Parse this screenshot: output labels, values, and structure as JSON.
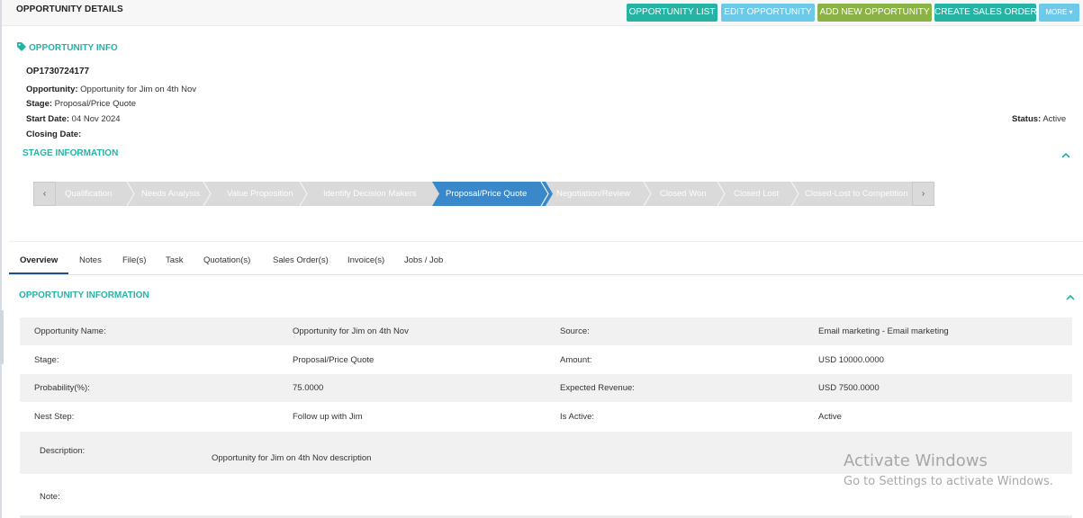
{
  "header": {
    "title": "OPPORTUNITY DETAILS",
    "buttons": {
      "list": "OPPORTUNITY LIST",
      "edit": "EDIT OPPORTUNITY",
      "add": "ADD NEW OPPORTUNITY",
      "sales_order": "CREATE SALES ORDER",
      "more": "MORE ▾"
    }
  },
  "info": {
    "title": "OPPORTUNITY INFO",
    "id": "OP1730724177",
    "opportunity_label": "Opportunity:",
    "opportunity_value": " Opportunity for Jim on 4th Nov",
    "stage_label": "Stage:",
    "stage_value": " Proposal/Price Quote",
    "start_label": "Start Date:",
    "start_value": " 04 Nov 2024",
    "closing_label": "Closing Date:",
    "closing_value": "",
    "status_label": "Status:",
    "status_value": " Active"
  },
  "stage_info": {
    "title": "STAGE INFORMATION",
    "prev": "‹",
    "next": "›",
    "stages": [
      "Qualification",
      "Needs Analysis",
      "Value Proposition",
      "Identify Decision Makers",
      "Proposal/Price Quote",
      "Negotiation/Review",
      "Closed Won",
      "Closed Lost",
      "Closed-Lost to Competition"
    ],
    "active_stage": "Proposal/Price Quote"
  },
  "tabs": [
    "Overview",
    "Notes",
    "File(s)",
    "Task",
    "Quotation(s)",
    "Sales Order(s)",
    "Invoice(s)",
    "Jobs / Job"
  ],
  "details": {
    "title": "OPPORTUNITY INFORMATION",
    "rows": [
      [
        "Opportunity Name:",
        "Opportunity for Jim on 4th Nov",
        "Source:",
        "Email marketing - Email marketing"
      ],
      [
        "Stage:",
        "Proposal/Price Quote",
        "Amount:",
        "USD 10000.0000"
      ],
      [
        "Probability(%):",
        "75.0000",
        "Expected Revenue:",
        "USD 7500.0000"
      ],
      [
        "Nest Step:",
        "Follow up with Jim",
        "Is Active:",
        "Active"
      ]
    ],
    "description_label": "Description:",
    "description_value": "Opportunity for Jim on 4th Nov description",
    "note_label": "Note:"
  },
  "watermark": {
    "line1": "Activate Windows",
    "line2": "Go to Settings to activate Windows."
  },
  "colors": {
    "teal": "#26b3a4",
    "light_blue": "#6cc9ea",
    "green": "#8ab244",
    "active_stage": "#3a88c9",
    "stage_bg": "#dadada"
  }
}
